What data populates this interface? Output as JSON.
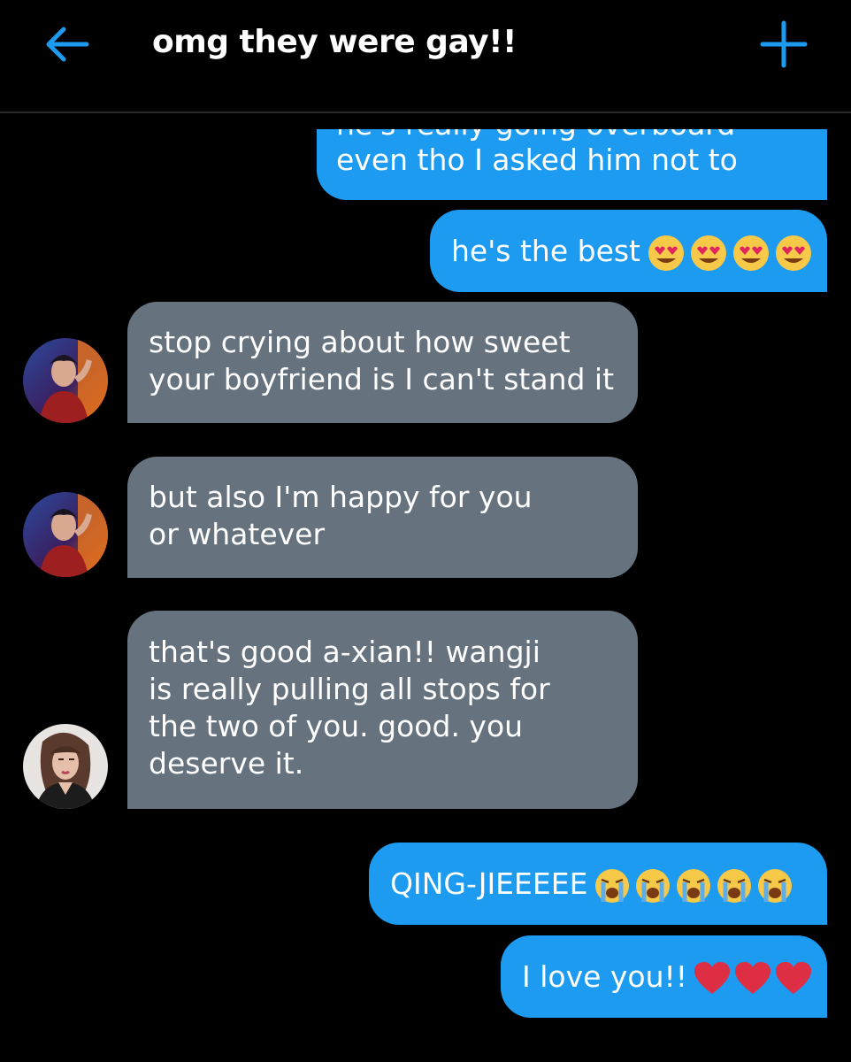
{
  "header": {
    "title": "omg they were gay!!",
    "back_icon": "arrow-left-icon",
    "add_icon": "plus-icon",
    "accent_color": "#1d9bf0"
  },
  "colors": {
    "sent_bubble": "#1d9bf0",
    "received_bubble": "#66727e",
    "background": "#000000"
  },
  "messages": [
    {
      "sender": "me",
      "lines": [
        "he's really going overboard",
        "even tho I asked him not to"
      ]
    },
    {
      "sender": "me",
      "text": "he's the best",
      "emoji": "heart-eyes-emoji",
      "emoji_count": 4
    },
    {
      "sender": "other",
      "avatar": "avatar-male",
      "lines": [
        "stop crying about how sweet",
        "your boyfriend is I can't stand it"
      ]
    },
    {
      "sender": "other",
      "avatar": "avatar-male",
      "lines": [
        "but also I'm happy for you",
        "or whatever"
      ]
    },
    {
      "sender": "other",
      "avatar": "avatar-female",
      "lines": [
        "that's good a-xian!! wangji",
        "is really pulling all stops for",
        "the two of you. good. you",
        "deserve it."
      ]
    },
    {
      "sender": "me",
      "text": "QING-JIEEEEE",
      "emoji": "loudly-crying-emoji",
      "emoji_count": 5
    },
    {
      "sender": "me",
      "text": "I love you!!",
      "emoji": "red-heart-emoji",
      "emoji_count": 3
    }
  ]
}
